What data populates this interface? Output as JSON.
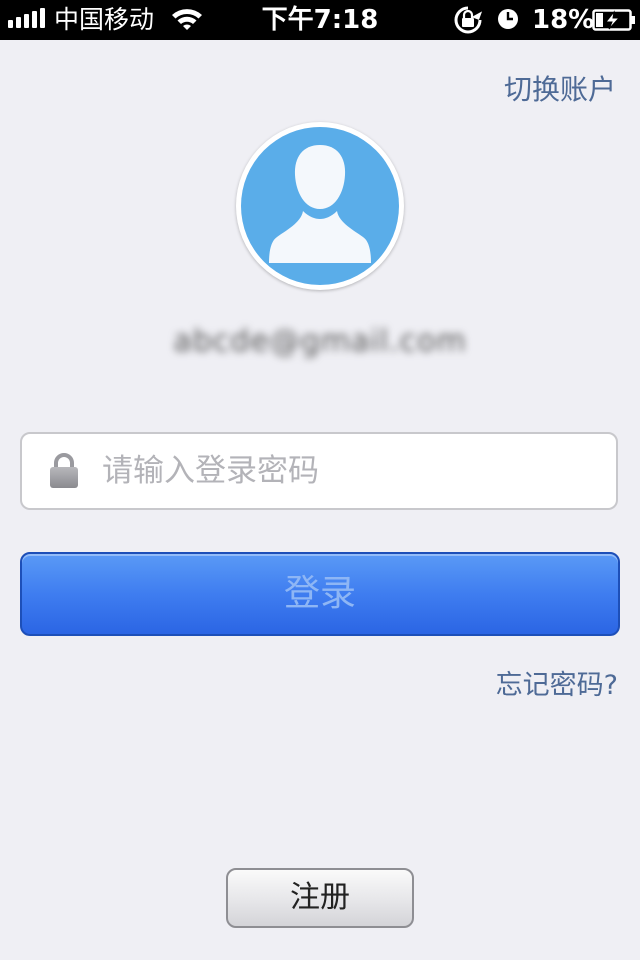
{
  "status_bar": {
    "carrier": "中国移动",
    "time": "下午7:18",
    "battery_percent": "18%",
    "signal_bars": 5,
    "icons": [
      "signal-icon",
      "wifi-icon",
      "rotation-lock-icon",
      "alarm-icon",
      "battery-icon"
    ]
  },
  "header": {
    "switch_account": "切换账户"
  },
  "profile": {
    "avatar_icon": "user-silhouette-icon",
    "avatar_color": "#5aade9",
    "account_name": "abcde@gmail.com"
  },
  "login_form": {
    "password_placeholder": "请输入登录密码",
    "password_value": "",
    "lock_icon": "lock-icon",
    "login_label": "登录",
    "forgot_password": "忘记密码?",
    "register_label": "注册"
  },
  "colors": {
    "link": "#4e6a96",
    "primary_button": "#3f7df0",
    "background": "#efeff4"
  }
}
